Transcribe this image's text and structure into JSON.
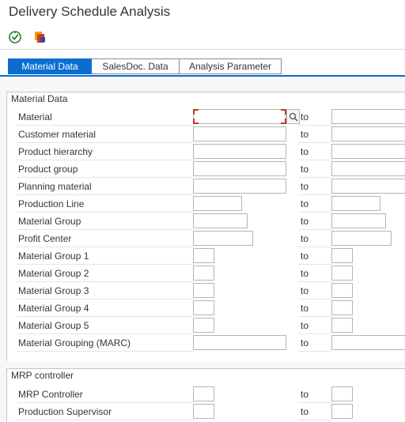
{
  "window": {
    "title": "Delivery Schedule Analysis"
  },
  "toolbar": {
    "buttons": [
      {
        "name": "execute-icon"
      },
      {
        "name": "variant-icon"
      }
    ]
  },
  "tabs": [
    {
      "label": "Material Data",
      "active": true
    },
    {
      "label": "SalesDoc. Data",
      "active": false
    },
    {
      "label": "Analysis Parameter",
      "active": false
    }
  ],
  "material_group": {
    "title": "Material Data",
    "to_label": "to",
    "rows": [
      {
        "label": "Material",
        "from": "",
        "to": ""
      },
      {
        "label": "Customer material",
        "from": "",
        "to": ""
      },
      {
        "label": "Product hierarchy",
        "from": "",
        "to": ""
      },
      {
        "label": "Product group",
        "from": "",
        "to": ""
      },
      {
        "label": "Planning material",
        "from": "",
        "to": ""
      },
      {
        "label": "Production Line",
        "from": "",
        "to": ""
      },
      {
        "label": "Material Group",
        "from": "",
        "to": ""
      },
      {
        "label": "Profit Center",
        "from": "",
        "to": ""
      },
      {
        "label": "Material Group 1",
        "from": "",
        "to": ""
      },
      {
        "label": "Material Group 2",
        "from": "",
        "to": ""
      },
      {
        "label": "Material Group 3",
        "from": "",
        "to": ""
      },
      {
        "label": "Material Group 4",
        "from": "",
        "to": ""
      },
      {
        "label": "Material Group 5",
        "from": "",
        "to": ""
      },
      {
        "label": "Material Grouping (MARC)",
        "from": "",
        "to": ""
      }
    ]
  },
  "mrp_group": {
    "title": "MRP controller",
    "to_label": "to",
    "rows": [
      {
        "label": "MRP Controller",
        "from": "",
        "to": ""
      },
      {
        "label": "Production Supervisor",
        "from": "",
        "to": ""
      }
    ]
  },
  "colors": {
    "accent": "#0a6ed1",
    "focus_marker": "#c0392b"
  }
}
